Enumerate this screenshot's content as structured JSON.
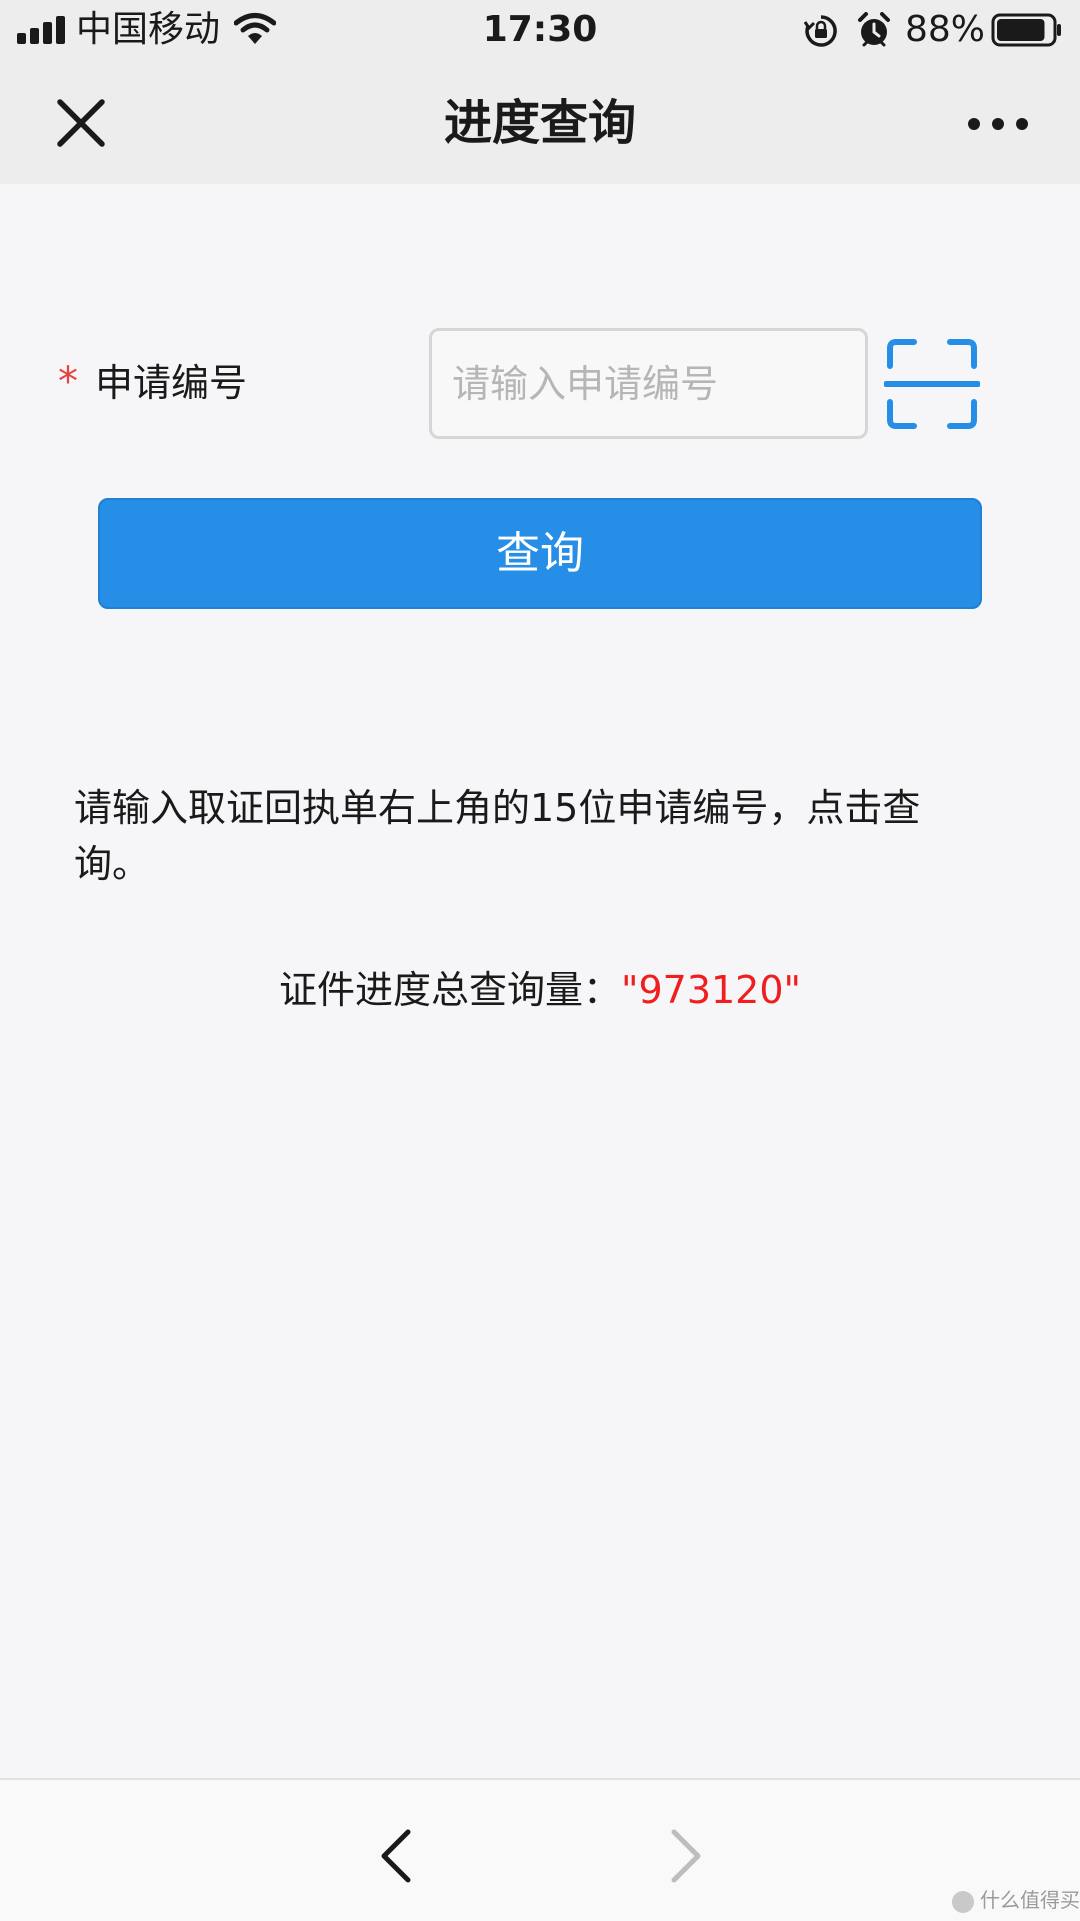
{
  "status_bar": {
    "carrier": "中国移动",
    "time": "17:30",
    "battery_percent": "88%",
    "battery_level": 0.88
  },
  "nav": {
    "title": "进度查询",
    "close_icon": "close-icon",
    "more_icon": "more-icon"
  },
  "form": {
    "required_mark": "*",
    "label": "申请编号",
    "input_placeholder": "请输入申请编号",
    "input_value": "",
    "scan_icon": "scan-icon",
    "query_button": "查询"
  },
  "hint": "请输入取证回执单右上角的15位申请编号，点击查询。",
  "total_query": {
    "label": "证件进度总查询量：",
    "value": "\"973120\""
  },
  "bottom_toolbar": {
    "back_icon": "chevron-left-icon",
    "forward_icon": "chevron-right-icon"
  },
  "watermark": "什么值得买",
  "colors": {
    "accent": "#268ee6",
    "required": "#e64340",
    "total_value": "#f01e1e",
    "bar_background": "#ededed",
    "page_background": "#f6f6f8"
  }
}
